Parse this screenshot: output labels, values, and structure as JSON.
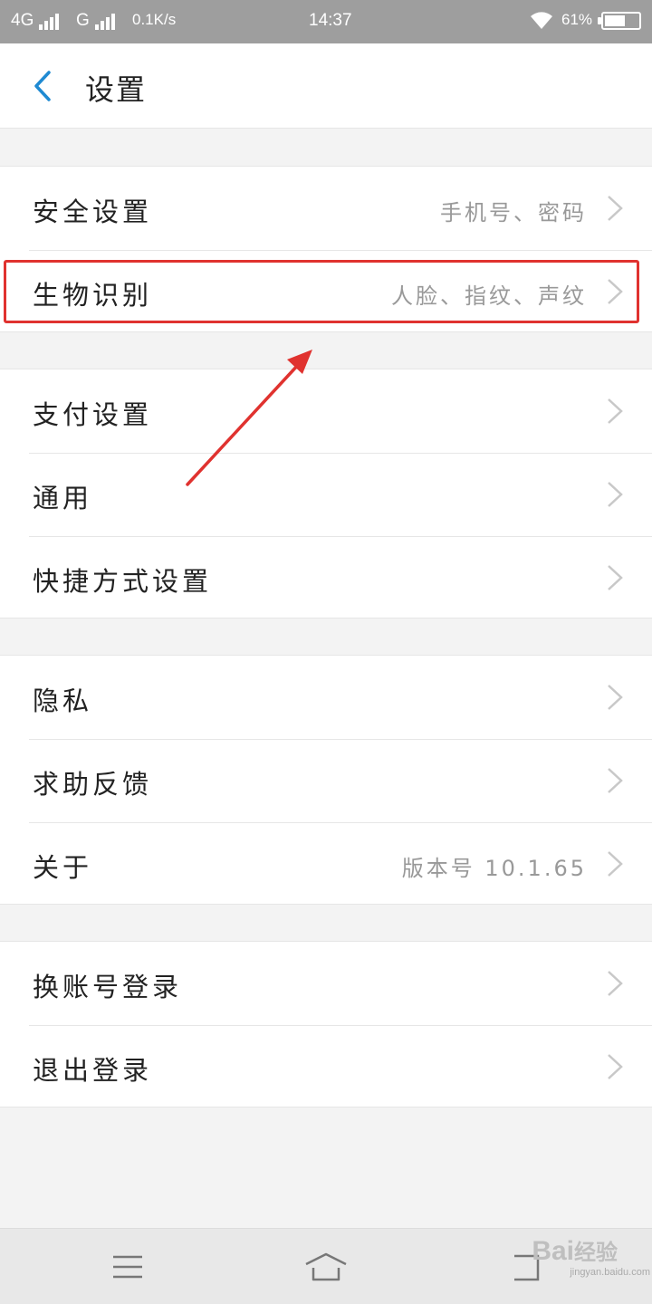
{
  "status_bar": {
    "network1": "4G",
    "network2": "G",
    "speed": "0.1K/s",
    "time": "14:37",
    "battery_percent": "61%",
    "battery_level": 0.61,
    "wifi_icon": "wifi-icon"
  },
  "header": {
    "title": "设置",
    "back_icon": "back-arrow-icon"
  },
  "groups": [
    {
      "items": [
        {
          "label": "安全设置",
          "value": "手机号、密码"
        },
        {
          "label": "生物识别",
          "value": "人脸、指纹、声纹"
        }
      ]
    },
    {
      "items": [
        {
          "label": "支付设置",
          "value": ""
        },
        {
          "label": "通用",
          "value": ""
        },
        {
          "label": "快捷方式设置",
          "value": ""
        }
      ]
    },
    {
      "items": [
        {
          "label": "隐私",
          "value": ""
        },
        {
          "label": "求助反馈",
          "value": ""
        },
        {
          "label": "关于",
          "value": "版本号 10.1.65"
        }
      ]
    },
    {
      "items": [
        {
          "label": "换账号登录",
          "value": ""
        },
        {
          "label": "退出登录",
          "value": ""
        }
      ]
    }
  ],
  "annotation": {
    "highlight_color": "#e0322f"
  },
  "navbar": {
    "menu_icon": "menu-icon",
    "home_icon": "home-icon",
    "back_icon": "back-icon"
  },
  "watermark": {
    "brand": "Bai",
    "brand_suffix": "经验",
    "url": "jingyan.baidu.com"
  }
}
